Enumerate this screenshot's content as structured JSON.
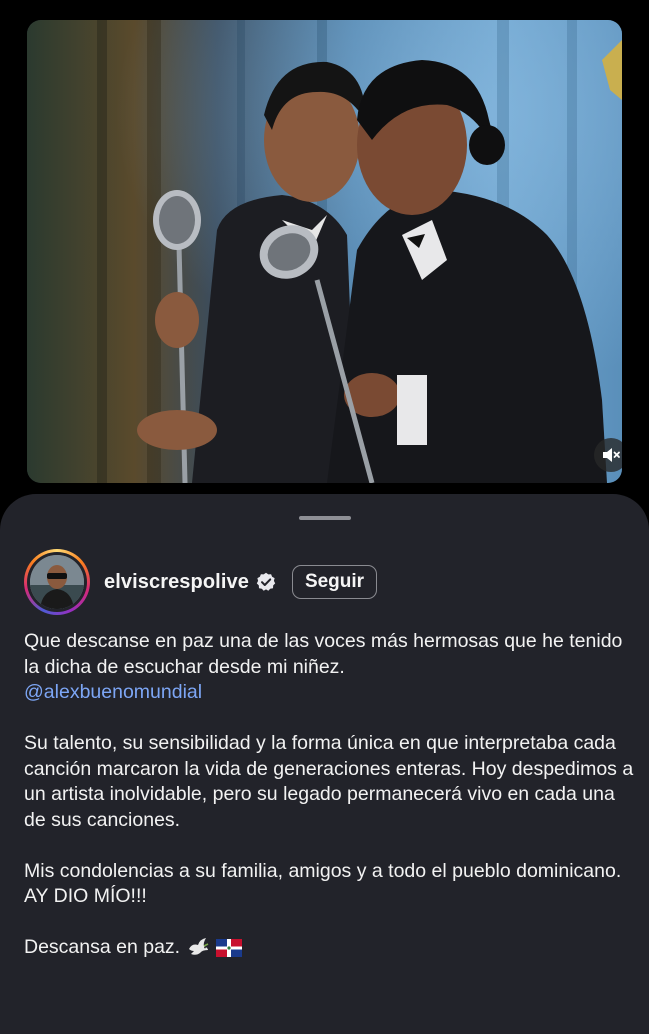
{
  "video": {
    "mute_icon": "speaker-muted-icon"
  },
  "profile": {
    "username": "elviscrespolive",
    "verified_icon": "verified-badge-icon",
    "follow_label": "Seguir"
  },
  "caption": {
    "paragraph1_text": "Que descanse en paz una de las voces más hermosas que he tenido la dicha de escuchar desde mi niñez.",
    "mention": "@alexbuenomundial",
    "paragraph2": "Su talento, su sensibilidad y la forma única en que interpretaba cada canción marcaron la vida de generaciones enteras. Hoy despedimos a un artista inolvidable, pero su legado permanecerá vivo en cada una de sus canciones.",
    "paragraph3": "Mis condolencias a su familia, amigos y a todo el pueblo dominicano. AY DIO MÍO!!!",
    "paragraph4": "Descansa en paz.",
    "emojis": [
      "dove-icon",
      "dominican-flag-icon"
    ]
  },
  "colors": {
    "sheet_background": "#22232a",
    "mention_link": "#7da6f5",
    "follow_border": "#8a8b91"
  }
}
